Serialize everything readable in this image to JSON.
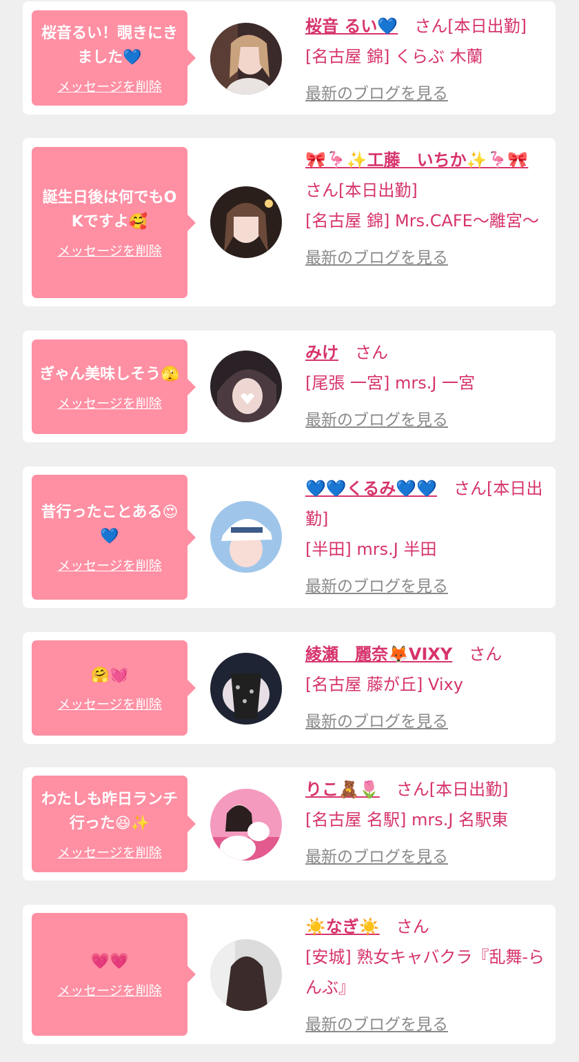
{
  "labels": {
    "delete": "メッセージを削除",
    "blog": "最新のブログを見る"
  },
  "cards": [
    {
      "message": "桜音るい！覗きにきました💙",
      "name": "桜音 るい💙",
      "suffix": "さん[本日出勤]",
      "shop": "[名古屋 錦] くらぶ 木蘭"
    },
    {
      "message": "誕生日後は何でもOKですよ🥰",
      "name": "🎀🦩✨工藤　いちか✨🦩🎀",
      "suffix": "さん[本日出勤]",
      "shop": "[名古屋 錦] Mrs.CAFE〜離宮〜"
    },
    {
      "message": "ぎゃん美味しそう🫣",
      "name": "みけ",
      "suffix": "さん",
      "shop": "[尾張 一宮] mrs.J 一宮"
    },
    {
      "message": "昔行ったことある😍💙",
      "name": "💙💙くるみ💙💙",
      "suffix": "さん[本日出勤]",
      "shop": "[半田] mrs.J 半田"
    },
    {
      "message": "🤗💓",
      "name": "綾瀬　麗奈🦊VIXY",
      "suffix": "さん",
      "shop": "[名古屋 藤が丘] Vixy"
    },
    {
      "message": "わたしも昨日ランチ行った😆✨",
      "name": "りこ🧸🌷",
      "suffix": "さん[本日出勤]",
      "shop": "[名古屋 名駅] mrs.J 名駅東"
    },
    {
      "message": "💗💗",
      "name": "☀️なぎ☀️",
      "suffix": "さん",
      "shop": "[安城] 熟女キャバクラ『乱舞-らんぶ』"
    }
  ],
  "colors": {
    "page_bg": "#efefef",
    "bubble": "#ff8fa3",
    "accent": "#d6336c",
    "link_gray": "#8a8a8a"
  }
}
